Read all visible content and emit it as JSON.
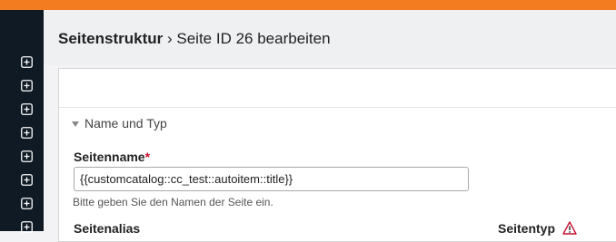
{
  "breadcrumb": {
    "section": "Seitenstruktur",
    "separator": "›",
    "page": "Seite ID 26 bearbeiten"
  },
  "sidebar": {
    "items": [
      {
        "icon": "plus-square-icon"
      },
      {
        "icon": "plus-square-icon"
      },
      {
        "icon": "plus-square-icon"
      },
      {
        "icon": "plus-square-icon"
      },
      {
        "icon": "plus-square-icon"
      },
      {
        "icon": "plus-square-icon"
      },
      {
        "icon": "plus-square-icon"
      },
      {
        "icon": "plus-square-icon"
      }
    ]
  },
  "form": {
    "legend": "Name und Typ",
    "name_label": "Seitenname",
    "required_mark": "*",
    "name_value": "{{customcatalog::cc_test::autoitem::title}}",
    "name_hint": "Bitte geben Sie den Namen der Seite ein.",
    "alias_label": "Seitenalias",
    "type_label": "Seitentyp",
    "type_warning_icon": "warning-icon"
  },
  "colors": {
    "topbar": "#f47c20",
    "sidebar": "#0f1a24",
    "required": "#c8102e"
  }
}
